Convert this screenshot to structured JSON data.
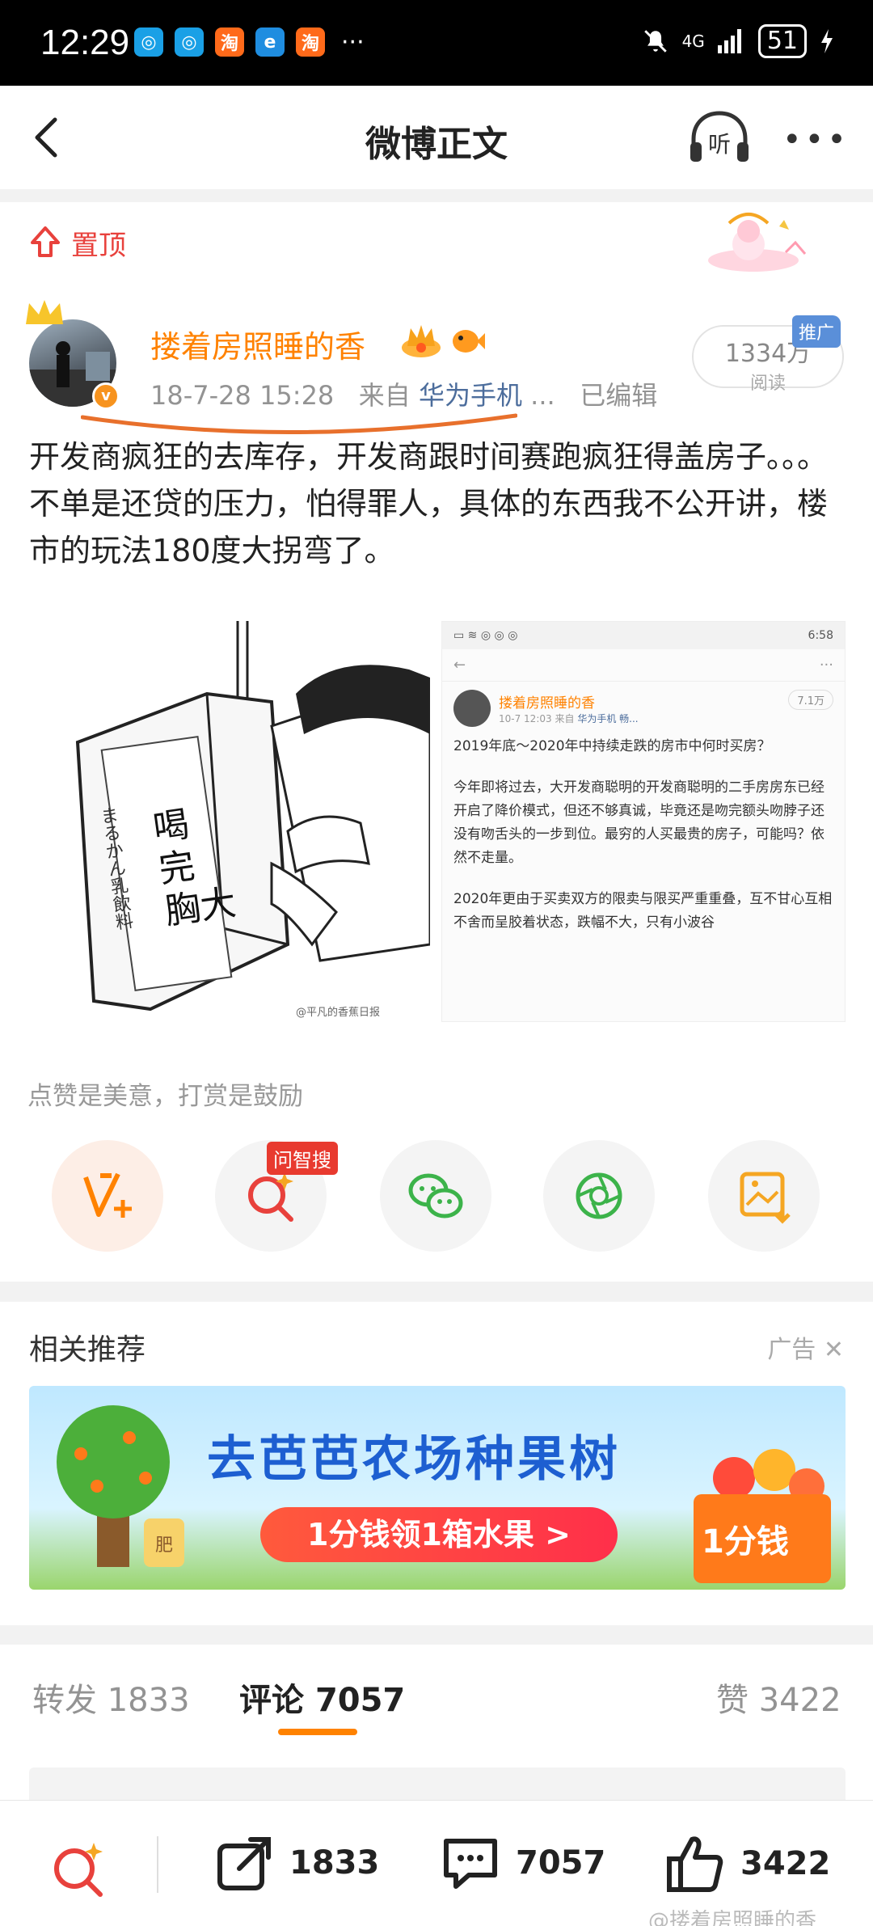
{
  "status_bar": {
    "time": "12:29",
    "app_icons": [
      "baidu-netdisk-icon",
      "baidu-netdisk-icon",
      "taobao-icon",
      "browser-icon",
      "taobao-icon"
    ],
    "app_glyph_tao": "淘",
    "more": "···",
    "network": "4G",
    "battery": "51"
  },
  "nav": {
    "title": "微博正文",
    "listen_label": "听",
    "more": "•••"
  },
  "pinned": {
    "label": "置顶"
  },
  "post": {
    "username": "搂着房照睡的香",
    "date": "18-7-28 15:28",
    "from_prefix": "来自",
    "source": "华为手机",
    "ellipsis": "...",
    "edited": "已编辑",
    "reads_count": "1334万",
    "reads_label": "阅读",
    "promo_tag": "推广",
    "text_lines": [
      "开发商疯狂的去库存，开发商跟时间赛跑疯狂得盖房子。。。",
      "不单是还贷的压力，怕得罪人，具体的东西我不公开讲，楼市的玩法180度大拐弯了。"
    ],
    "image_left": {
      "carton_text_big": "喝完胸大",
      "carton_text_small": "まるかん乳飲料",
      "watermark": "@平凡的香蕉日报"
    },
    "image_right": {
      "time": "6:58",
      "username": "搂着房照睡的香",
      "date": "10-7 12:03",
      "from_prefix": "来自",
      "source": "华为手机 畅...",
      "reads": "7.1万",
      "paragraphs": [
        "2019年底～2020年中持续走跌的房市中何时买房？",
        "今年即将过去，大开发商聪明的开发商聪明的二手房房东已经开启了降价模式，但还不够真诚，毕竟还是吻完额头吻脖子还没有吻舌头的一步到位。最穷的人买最贵的房子，可能吗？依然不走量。",
        "2020年更由于买卖双方的限卖与限买严重重叠，互不甘心互相不舍而呈胶着状态，跌幅不大，只有小波谷"
      ]
    },
    "like_text": "点赞是美意，打赏是鼓励",
    "search_tag": "问智搜"
  },
  "related": {
    "title": "相关推荐",
    "ad_label": "广告",
    "close": "✕",
    "banner_title": "去芭芭农场种果树",
    "banner_button": "1分钱领1箱水果 >",
    "banner_box_text": "1分钱",
    "banner_pot_text": "肥"
  },
  "tabs": {
    "repost_label": "转发",
    "repost_count": "1833",
    "comment_label": "评论",
    "comment_count": "7057",
    "like_label": "赞",
    "like_count": "3422"
  },
  "bottom": {
    "repost_count": "1833",
    "comment_count": "7057",
    "like_count": "3422",
    "watermark": "@搂着房照睡的香"
  },
  "colors": {
    "accent_orange": "#ff8200",
    "pin_red": "#e8413c",
    "link_blue": "#4c6d9c"
  }
}
